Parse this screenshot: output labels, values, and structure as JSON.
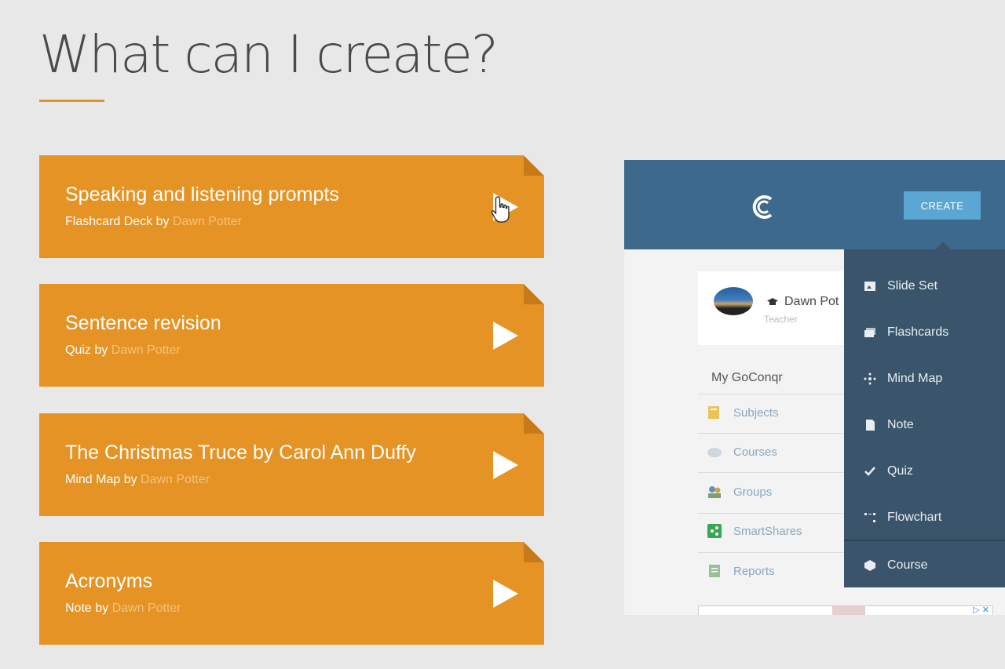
{
  "page": {
    "title": "What can I create?"
  },
  "cards": [
    {
      "title": "Speaking and listening prompts",
      "type_prefix": "Flashcard Deck by",
      "author": "Dawn Potter"
    },
    {
      "title": "Sentence revision",
      "type_prefix": "Quiz by",
      "author": "Dawn Potter"
    },
    {
      "title": "The Christmas Truce by Carol Ann Duffy",
      "type_prefix": "Mind Map by",
      "author": "Dawn Potter"
    },
    {
      "title": "Acronyms",
      "type_prefix": "Note by",
      "author": "Dawn Potter"
    }
  ],
  "app": {
    "create_label": "CREATE",
    "profile": {
      "name": "Dawn Pot",
      "role": "Teacher"
    },
    "nav_heading": "My GoConqr",
    "nav_items": [
      {
        "label": "Subjects",
        "icon": "subjects-icon"
      },
      {
        "label": "Courses",
        "icon": "courses-icon"
      },
      {
        "label": "Groups",
        "icon": "groups-icon"
      },
      {
        "label": "SmartShares",
        "icon": "smartshares-icon"
      },
      {
        "label": "Reports",
        "icon": "reports-icon"
      }
    ],
    "create_menu": [
      {
        "label": "Slide Set",
        "icon": "slide-set-icon"
      },
      {
        "label": "Flashcards",
        "icon": "flashcards-icon"
      },
      {
        "label": "Mind Map",
        "icon": "mind-map-icon"
      },
      {
        "label": "Note",
        "icon": "note-icon"
      },
      {
        "label": "Quiz",
        "icon": "check-icon"
      },
      {
        "label": "Flowchart",
        "icon": "flowchart-icon"
      },
      {
        "label": "Course",
        "icon": "course-icon"
      }
    ]
  },
  "colors": {
    "card": "#e59324",
    "card_author": "#f5c27a",
    "accent_line": "#e0952a",
    "app_header": "#3d6a8c",
    "create_button": "#5aa7d4",
    "dropdown": "#3a556b"
  }
}
